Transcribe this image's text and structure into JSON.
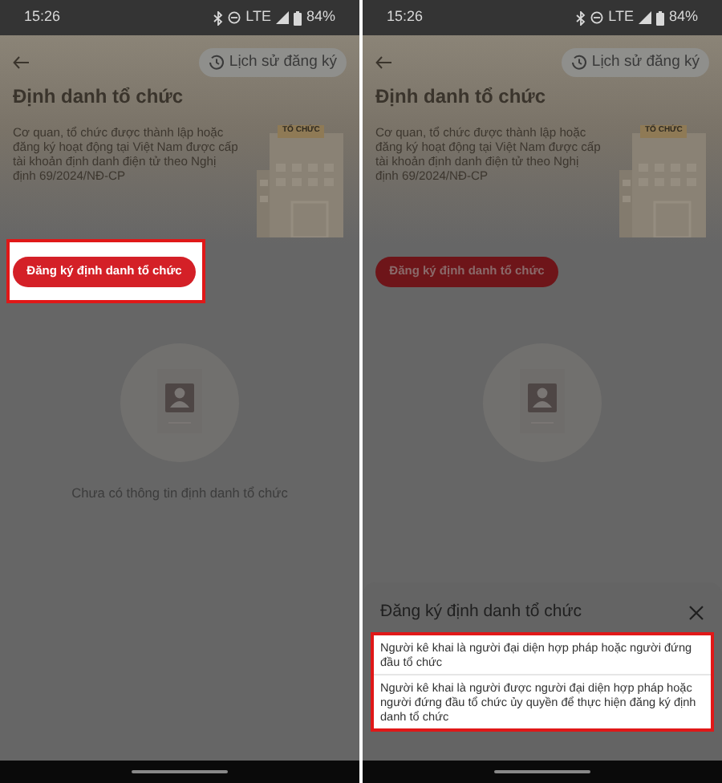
{
  "screens": [
    {
      "status_bar": {
        "time": "15:26",
        "network": "LTE",
        "battery": "84%"
      },
      "history_button": "Lịch sử đăng ký",
      "title": "Định danh tổ chức",
      "description": "Cơ quan, tổ chức được thành lập hoặc đăng ký hoạt động tại Việt Nam được cấp tài khoản định danh điện tử theo Nghị định 69/2024/NĐ-CP",
      "illustration_label": "TỔ CHỨC",
      "register_button": {
        "label": "Đăng ký định danh tổ chức",
        "highlighted": true
      },
      "empty_text": "Chưa có thông tin định danh tổ chức"
    },
    {
      "status_bar": {
        "time": "15:26",
        "network": "LTE",
        "battery": "84%"
      },
      "history_button": "Lịch sử đăng ký",
      "title": "Định danh tổ chức",
      "description": "Cơ quan, tổ chức được thành lập hoặc đăng ký hoạt động tại Việt Nam được cấp tài khoản định danh điện tử theo Nghị định 69/2024/NĐ-CP",
      "illustration_label": "TỔ CHỨC",
      "register_button": {
        "label": "Đăng ký định danh tổ chức",
        "highlighted": false
      },
      "sheet": {
        "title": "Đăng ký định danh tổ chức",
        "highlighted": true,
        "options": [
          "Người kê khai là người đại diện hợp pháp hoặc người đứng đầu tổ chức",
          "Người kê khai là người được người đại diện hợp pháp hoặc người đứng đầu tổ chức ủy quyền để thực hiện đăng ký định danh tổ chức"
        ]
      }
    }
  ]
}
